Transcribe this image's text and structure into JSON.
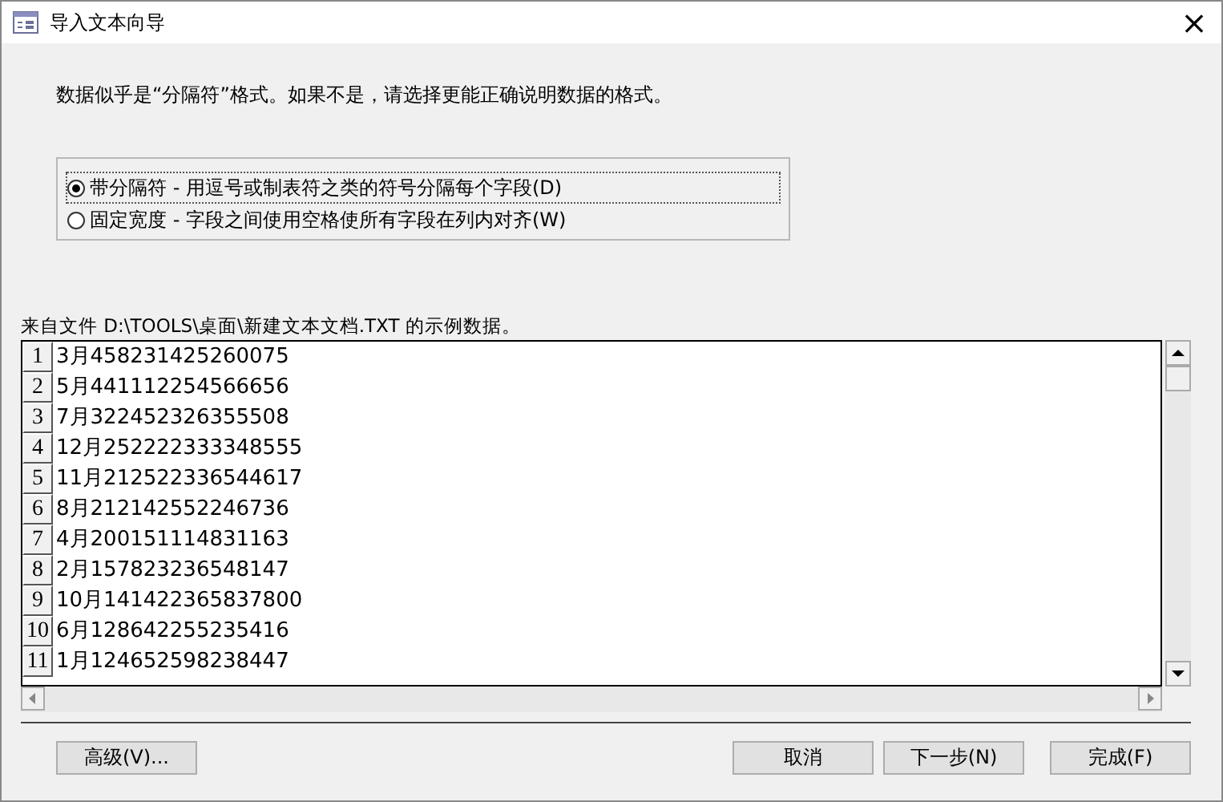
{
  "window": {
    "title": "导入文本向导",
    "close": "×"
  },
  "intro": "数据似乎是“分隔符”格式。如果不是，请选择更能正确说明数据的格式。",
  "format_options": [
    {
      "label": "带分隔符 - 用逗号或制表符之类的符号分隔每个字段(D)",
      "selected": true
    },
    {
      "label": "固定宽度 - 字段之间使用空格使所有字段在列内对齐(W)",
      "selected": false
    }
  ],
  "preview": {
    "caption": "来自文件 D:\\TOOLS\\桌面\\新建文本文档.TXT 的示例数据。",
    "rows": [
      {
        "number": "1",
        "text": "3月458231425260075"
      },
      {
        "number": "2",
        "text": "5月441112254566656"
      },
      {
        "number": "3",
        "text": "7月322452326355508"
      },
      {
        "number": "4",
        "text": "12月252222333348555"
      },
      {
        "number": "5",
        "text": "11月212522336544617"
      },
      {
        "number": "6",
        "text": "8月212142552246736"
      },
      {
        "number": "7",
        "text": "4月200151114831163"
      },
      {
        "number": "8",
        "text": "2月157823236548147"
      },
      {
        "number": "9",
        "text": "10月141422365837800"
      },
      {
        "number": "10",
        "text": "6月128642255235416"
      },
      {
        "number": "11",
        "text": "1月124652598238447"
      }
    ]
  },
  "buttons": [
    {
      "label": "高级(V)...",
      "kind": "left"
    },
    {
      "label": "取消",
      "kind": "right"
    },
    {
      "label": "下一步(N)",
      "kind": "right"
    },
    {
      "label": "完成(F)",
      "kind": "right"
    }
  ]
}
